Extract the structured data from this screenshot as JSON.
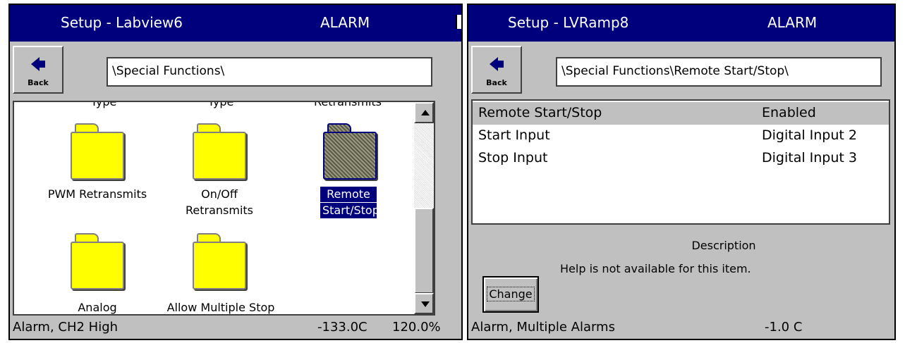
{
  "left": {
    "title": "Setup - Labview6",
    "mode": "ALARM",
    "back_label": "Back",
    "path": "\\Special Functions\\",
    "cut_labels": [
      "Type",
      "Type",
      "Retransmits"
    ],
    "folders": [
      {
        "label1": "PWM Retransmits",
        "label2": ""
      },
      {
        "label1": "On/Off",
        "label2": "Retransmits"
      },
      {
        "label1": "Remote",
        "label2": "Start/Stop"
      },
      {
        "label1": "Analog",
        "label2": ""
      },
      {
        "label1": "Allow Multiple Stop",
        "label2": ""
      }
    ],
    "status": {
      "message": "Alarm, CH2 High",
      "value": "-133.0C",
      "percent": "120.0%"
    }
  },
  "right": {
    "title": "Setup - LVRamp8",
    "mode": "ALARM",
    "back_label": "Back",
    "path": "\\Special Functions\\Remote Start/Stop\\",
    "rows": [
      {
        "name": "Remote Start/Stop",
        "value": "Enabled"
      },
      {
        "name": "Start Input",
        "value": "Digital Input 2"
      },
      {
        "name": "Stop Input",
        "value": "Digital Input 3"
      }
    ],
    "description_title": "Description",
    "description_text": "Help is not available for this item.",
    "change_label": "Change",
    "status": {
      "message": "Alarm, Multiple Alarms",
      "value": "-1.0 C"
    }
  },
  "colors": {
    "titlebar": "#00007c",
    "panel": "#c0c0c0",
    "folder": "#ffff00"
  }
}
